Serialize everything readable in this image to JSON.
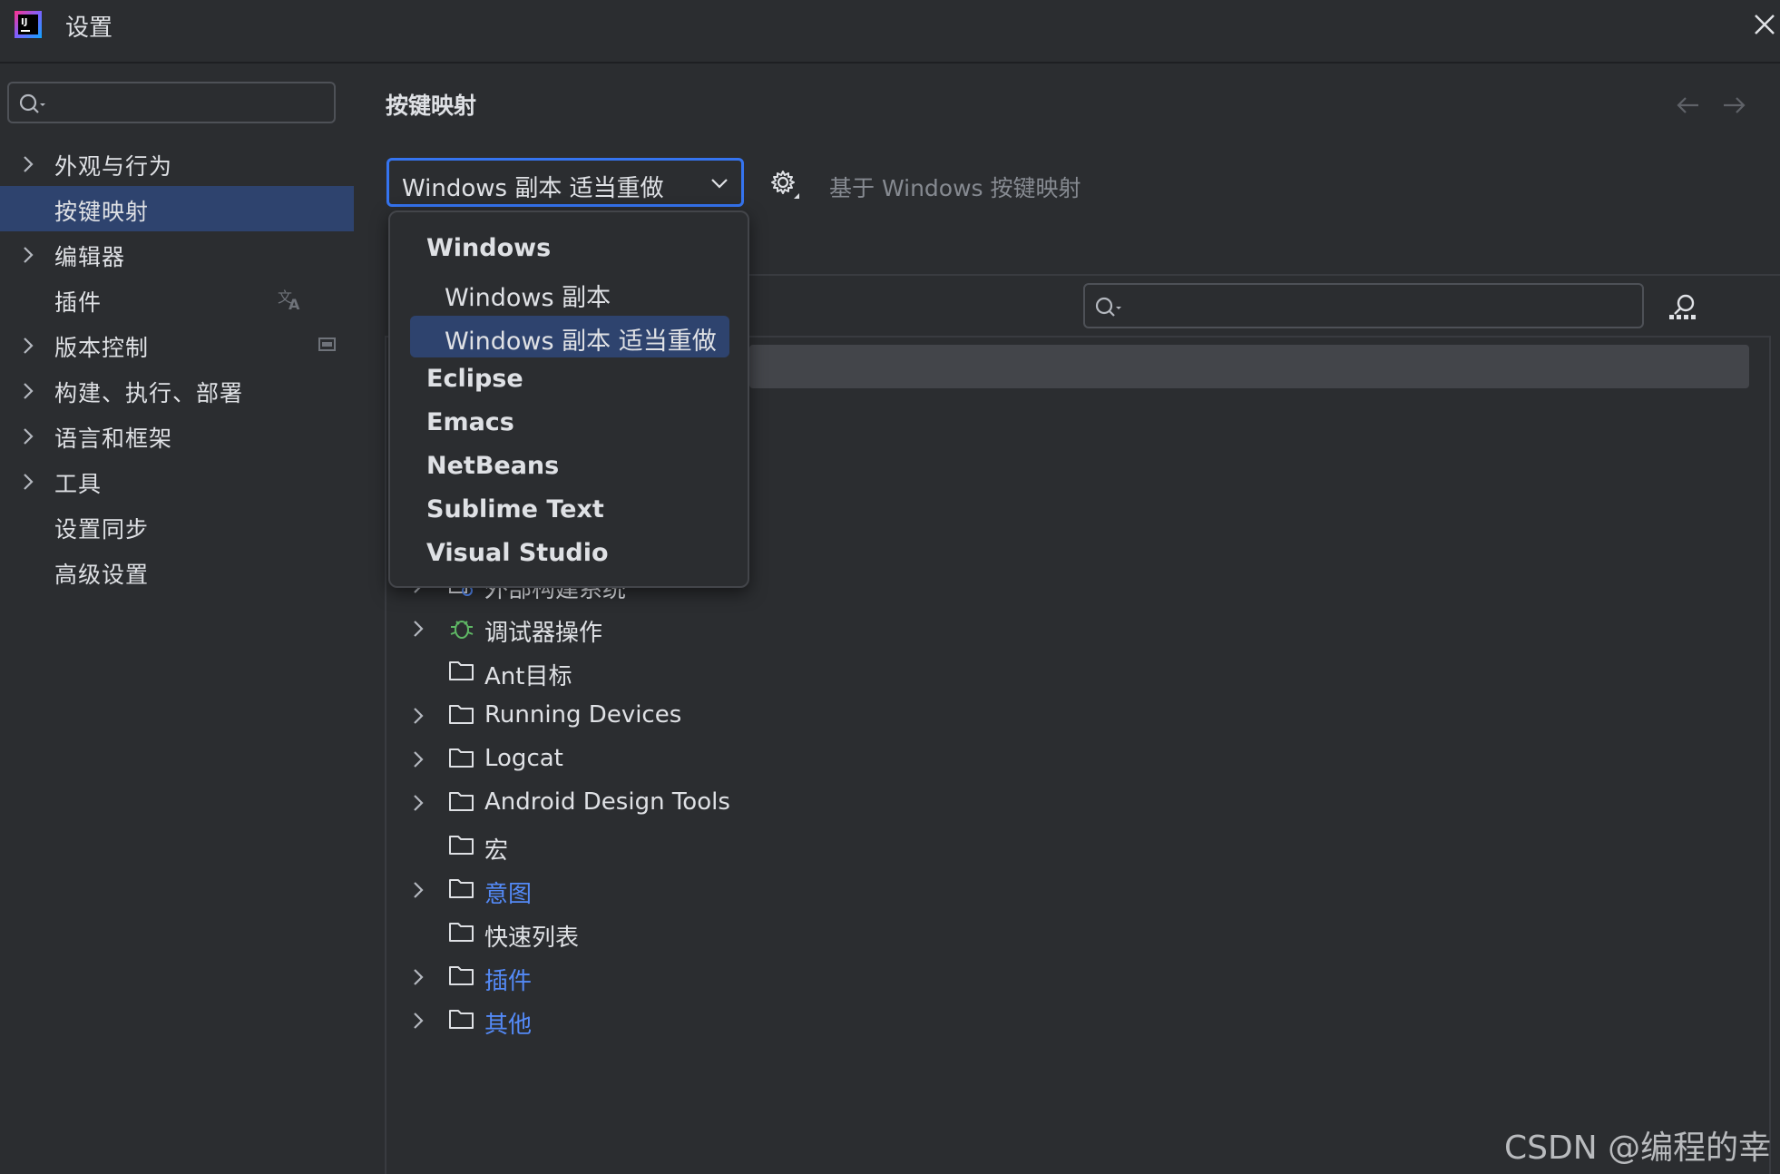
{
  "window": {
    "title": "设置",
    "logo_icon": "intellij-logo-icon",
    "close_icon": "close-icon"
  },
  "sidebar": {
    "search_placeholder": "",
    "items": [
      {
        "label": "外观与行为",
        "expandable": true
      },
      {
        "label": "按键映射",
        "expandable": false,
        "selected": true
      },
      {
        "label": "编辑器",
        "expandable": true
      },
      {
        "label": "插件",
        "expandable": false,
        "trailing_icon": "translate-icon"
      },
      {
        "label": "版本控制",
        "expandable": true,
        "trailing_icon": "project-scope-icon"
      },
      {
        "label": "构建、执行、部署",
        "expandable": true
      },
      {
        "label": "语言和框架",
        "expandable": true
      },
      {
        "label": "工具",
        "expandable": true
      },
      {
        "label": "设置同步",
        "expandable": false
      },
      {
        "label": "高级设置",
        "expandable": false
      }
    ]
  },
  "main": {
    "title": "按键映射",
    "keymap_selected": "Windows 副本 适当重做",
    "based_on": "基于 Windows 按键映射",
    "search_placeholder": ""
  },
  "keymap_popup": {
    "items": [
      {
        "label": "Windows",
        "kind": "group"
      },
      {
        "label": "Windows 副本",
        "kind": "sub"
      },
      {
        "label": "Windows 副本 适当重做",
        "kind": "sub",
        "selected": true
      },
      {
        "label": "Eclipse",
        "kind": "group"
      },
      {
        "label": "Emacs",
        "kind": "group"
      },
      {
        "label": "NetBeans",
        "kind": "group"
      },
      {
        "label": "Sublime Text",
        "kind": "group"
      },
      {
        "label": "Visual Studio",
        "kind": "group"
      }
    ]
  },
  "tree": {
    "rows": [
      {
        "label": "外部构建系统",
        "expandable": true,
        "icon": "external-build-icon",
        "link": false
      },
      {
        "label": "调试器操作",
        "expandable": true,
        "icon": "bug-icon",
        "link": false
      },
      {
        "label": "Ant目标",
        "expandable": false,
        "icon": "folder-icon",
        "link": false
      },
      {
        "label": "Running Devices",
        "expandable": true,
        "icon": "folder-icon",
        "link": false
      },
      {
        "label": "Logcat",
        "expandable": true,
        "icon": "folder-icon",
        "link": false
      },
      {
        "label": "Android Design Tools",
        "expandable": true,
        "icon": "folder-icon",
        "link": false
      },
      {
        "label": "宏",
        "expandable": false,
        "icon": "folder-icon",
        "link": false
      },
      {
        "label": "意图",
        "expandable": true,
        "icon": "folder-icon",
        "link": true
      },
      {
        "label": "快速列表",
        "expandable": false,
        "icon": "folder-icon",
        "link": false
      },
      {
        "label": "插件",
        "expandable": true,
        "icon": "folder-icon",
        "link": true
      },
      {
        "label": "其他",
        "expandable": true,
        "icon": "folder-icon",
        "link": true
      }
    ]
  },
  "watermark": "CSDN @编程的幸",
  "colors": {
    "background": "#2b2d30",
    "selection": "#2e436e",
    "accent": "#3574f0",
    "link": "#548af7",
    "muted_text": "#868a91"
  }
}
